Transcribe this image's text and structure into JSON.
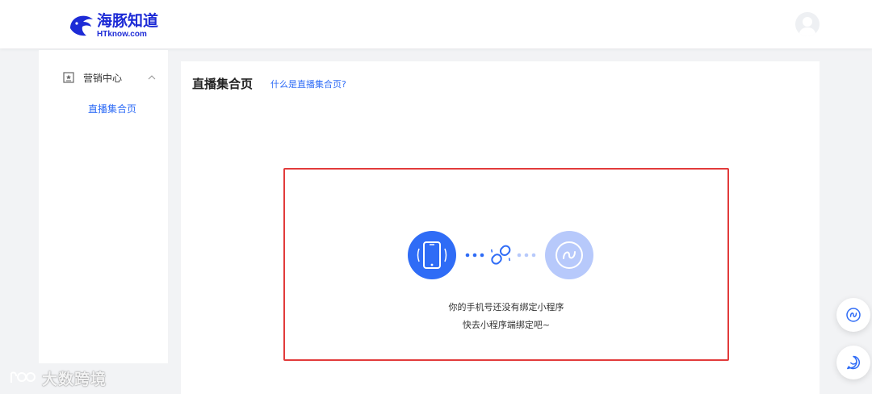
{
  "header": {
    "logo_cn": "海豚知道",
    "logo_en": "HTknow.com",
    "brand_color": "#1d2bd6"
  },
  "sidebar": {
    "group": {
      "label": "营销中心",
      "icon": "star-badge-icon",
      "expanded": true
    },
    "items": [
      {
        "label": "直播集合页",
        "active": true
      }
    ]
  },
  "main": {
    "title": "直播集合页",
    "help_link": "什么是直播集合页?",
    "empty_state": {
      "line1": "你的手机号还没有绑定小程序",
      "line2": "快去小程序端绑定吧~",
      "icons": [
        "phone-icon",
        "link-icon",
        "mini-program-icon"
      ]
    }
  },
  "floating": {
    "buttons": [
      {
        "icon": "mini-program-icon"
      },
      {
        "icon": "chat-icon"
      }
    ]
  },
  "watermark": {
    "text": "大数跨境"
  },
  "colors": {
    "accent": "#2f6cf6",
    "highlight_border": "#e23b3b",
    "light_accent": "#b7c9fb"
  }
}
